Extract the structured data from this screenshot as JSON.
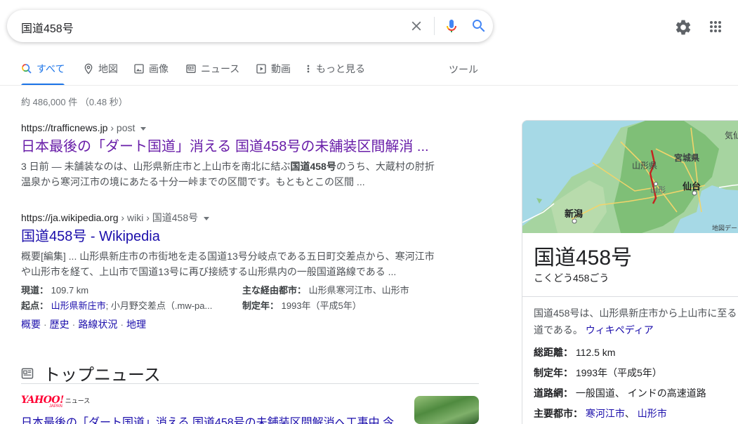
{
  "search": {
    "query": "国道458号"
  },
  "tabs": [
    {
      "label": "すべて"
    },
    {
      "label": "地図"
    },
    {
      "label": "画像"
    },
    {
      "label": "ニュース"
    },
    {
      "label": "動画"
    },
    {
      "label": "もっと見る"
    }
  ],
  "tools_label": "ツール",
  "stats": "約 486,000 件 （0.48 秒）",
  "results": [
    {
      "cite_domain": "https://trafficnews.jp",
      "cite_path": " › post",
      "title": "日本最後の「ダート国道」消える 国道458号の未舗装区間解消 ...",
      "snippet_line1_pre": "3 日前 — 未舗装なのは、山形県新庄市と上山市を南北に結ぶ",
      "snippet_line1_bold": "国道458号",
      "snippet_line1_post": "のうち、大蔵村の肘折",
      "snippet_line2": "温泉から寒河江市の境にあたる十分一峠までの区間です。もともとこの区間 ..."
    },
    {
      "cite_domain": "https://ja.wikipedia.org",
      "cite_path": " › wiki › 国道458号",
      "title": "国道458号 - Wikipedia",
      "snippet_line1": "概要[編集] ... 山形県新庄市の市街地を走る国道13号分岐点である五日町交差点から、寒河江市",
      "snippet_line2": "や山形市を経て、上山市で国道13号に再び接続する山形県内の一般国道路線である ..."
    }
  ],
  "facts": {
    "length_label": "現道：",
    "length_value": "109.7 km",
    "cities_label": "主な経由都市：",
    "cities_value": "山形県寒河江市、山形市",
    "start_label": "起点：",
    "start_link": "山形県新庄市",
    "start_rest": "; 小月野交差点（.mw-pa...",
    "year_label": "制定年：",
    "year_value": "1993年（平成5年）"
  },
  "sitelinks": [
    "概要",
    "歴史",
    "路線状況",
    "地理"
  ],
  "topnews": {
    "heading": "トップニュース",
    "source_logo": "YAHOO!",
    "source_japan": "JAPAN",
    "source_news": "ニュース",
    "title": "日本最後の「ダート国道」消える 国道458号の未舗装区間解消へ工事中 今"
  },
  "kp": {
    "map_labels": {
      "miyagi": "宮城県",
      "yamagata_pref": "山形県",
      "yamagata_city": "山形",
      "sendai": "仙台",
      "niigata": "新潟",
      "kesennuma": "気仙",
      "credit": "地図デー"
    },
    "title": "国道458号",
    "reading": "こくどう458ごう",
    "desc_line1": "国道458号は、山形県新庄市から上山市に至る",
    "desc_line2": "道である。",
    "desc_link": "ウィキペディア",
    "total_label": "総距離：",
    "total_value": "112.5 km",
    "year_label": "制定年：",
    "year_value": "1993年（平成5年）",
    "network_label": "道路網：",
    "network_value": "一般国道、 インドの高速道路",
    "cities_label": "主要都市：",
    "cities_link1": "寒河江市",
    "cities_sep": "、 ",
    "cities_link2": "山形市"
  },
  "colors": {
    "link": "#1a0dab",
    "visited": "#681da8",
    "accent": "#1a73e8"
  }
}
